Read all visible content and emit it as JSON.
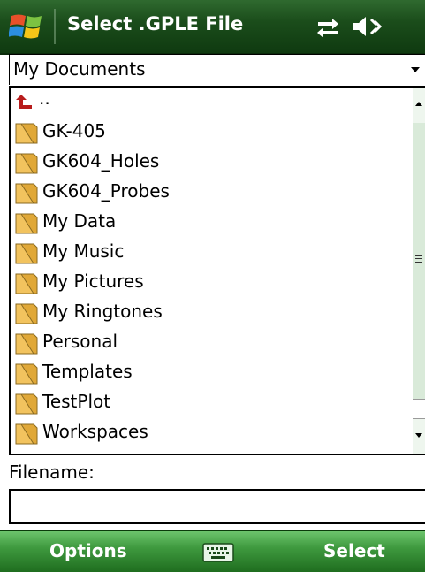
{
  "window": {
    "title": "Select .GPLE File"
  },
  "status_icons": [
    "sync-icon",
    "volume-icon"
  ],
  "location": {
    "selected": "My Documents"
  },
  "list": {
    "up_label": "..",
    "items": [
      "GK-405",
      "GK604_Holes",
      "GK604_Probes",
      "My Data",
      "My Music",
      "My Pictures",
      "My Ringtones",
      "Personal",
      "Templates",
      "TestPlot",
      "Workspaces"
    ]
  },
  "filename": {
    "label": "Filename:",
    "value": ""
  },
  "softkeys": {
    "left": "Options",
    "right": "Select",
    "center_icon": "keyboard-icon"
  },
  "colors": {
    "titlebar": "#1b4d1b",
    "softkey_bar": "#3f9a3f",
    "folder": "#f2c35e",
    "up_arrow": "#b81c1c"
  }
}
